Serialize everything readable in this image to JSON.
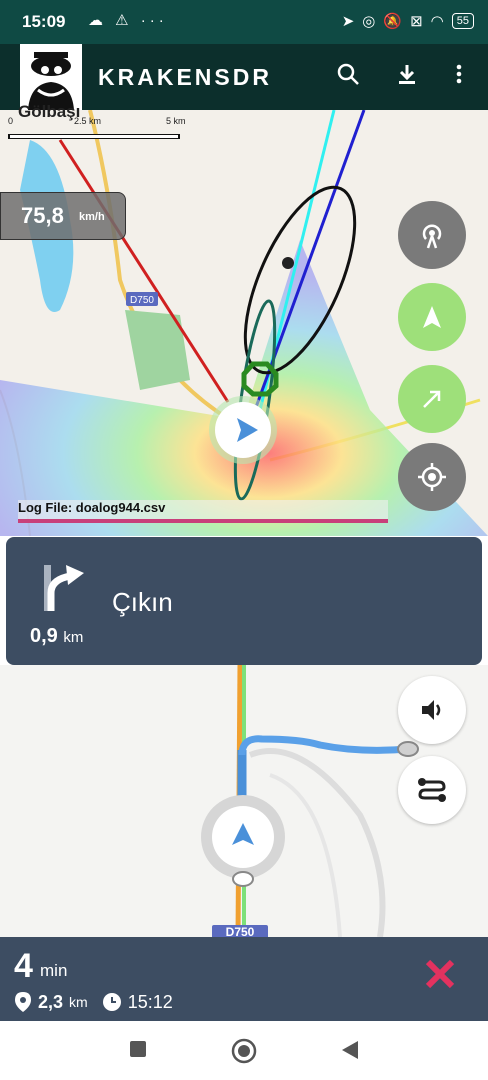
{
  "status_bar": {
    "time": "15:09",
    "left_icons": "☁ ⚠ ···",
    "battery": "55"
  },
  "app_bar": {
    "title": "KRAKENSDR",
    "search_icon": "search-icon",
    "download_icon": "download-icon",
    "more_icon": "more-vert-icon"
  },
  "map_top": {
    "place_label": "Gölbaşı",
    "scale_labels": [
      "0",
      "2.5 km",
      "5 km"
    ],
    "road_label": "D750",
    "speed_value": "75,8",
    "speed_unit": "km/h",
    "log_file": "Log File: doalog944.csv",
    "buttons": [
      "antenna-icon",
      "navigation-arrow-icon",
      "direction-arrow-icon",
      "locate-icon"
    ]
  },
  "nav_card": {
    "instruction": "Çıkın",
    "distance_value": "0,9",
    "distance_unit": "km",
    "turn_icon": "turn-right-icon"
  },
  "map_bottom": {
    "road_label": "D750",
    "sound_icon": "volume-icon",
    "route_icon": "route-icon"
  },
  "eta_bar": {
    "minutes": "4",
    "minutes_unit": "min",
    "distance_value": "2,3",
    "distance_unit": "km",
    "arrival_time": "15:12",
    "close_icon": "close-icon"
  },
  "colors": {
    "status_bar": "#0f4a44",
    "app_bar": "#0c2f2c",
    "card": "#3d4d62",
    "accent_green": "#9ee07a",
    "close_red": "#e3325f",
    "route_blue": "#4a90d9"
  }
}
